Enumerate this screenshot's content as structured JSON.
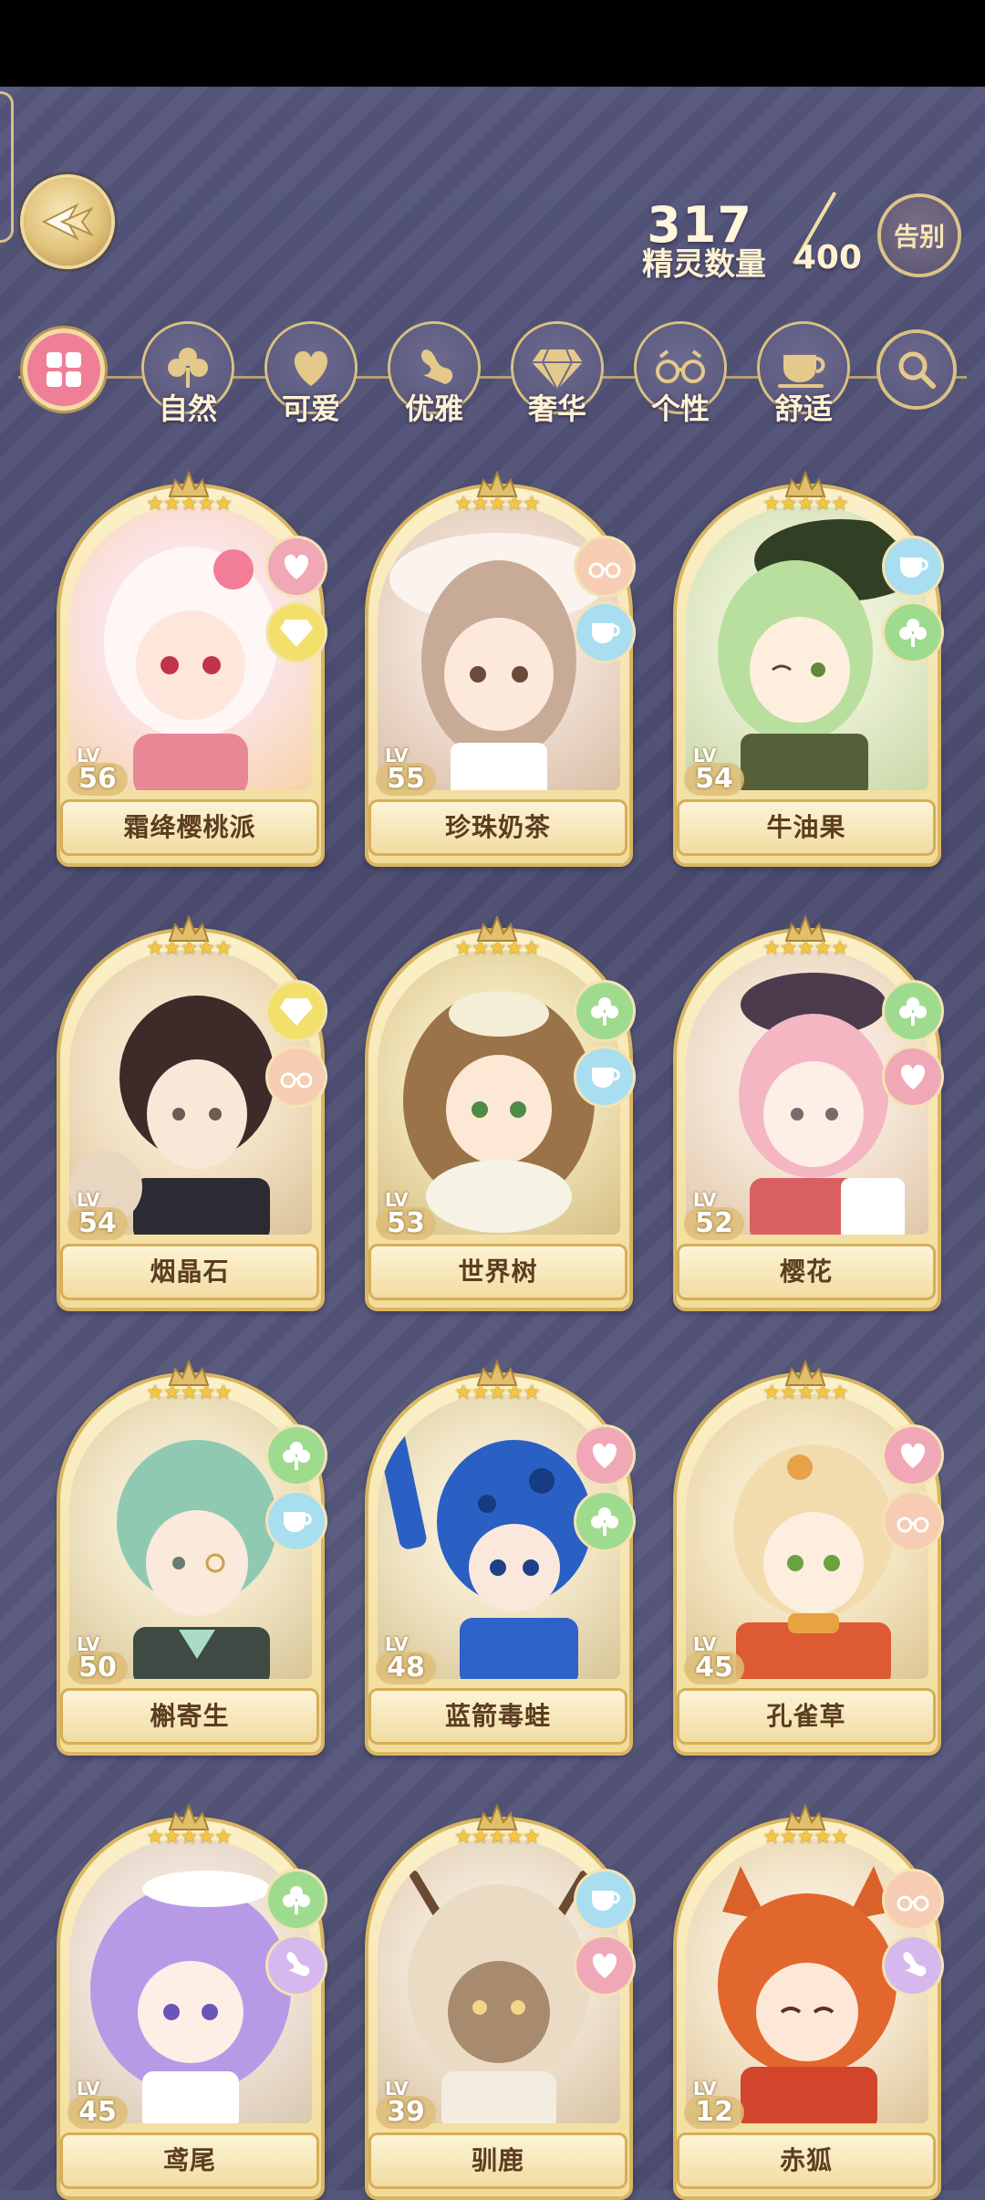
{
  "header": {
    "spirit_count": "317",
    "spirit_label": "精灵数量",
    "spirit_max": "400",
    "farewell_label": "告别"
  },
  "filters": [
    {
      "label": "自然",
      "icon": "clover-icon"
    },
    {
      "label": "可爱",
      "icon": "heart-icon"
    },
    {
      "label": "优雅",
      "icon": "swan-icon"
    },
    {
      "label": "奢华",
      "icon": "gem-icon"
    },
    {
      "label": "个性",
      "icon": "glasses-icon"
    },
    {
      "label": "舒适",
      "icon": "cup-icon"
    }
  ],
  "lv_prefix": "LV",
  "cards": [
    {
      "name": "霜绛樱桃派",
      "level": "56",
      "stars": "★★★★★",
      "badges": [
        "heart",
        "gem"
      ]
    },
    {
      "name": "珍珠奶茶",
      "level": "55",
      "stars": "★★★★★",
      "badges": [
        "glasses",
        "cup"
      ]
    },
    {
      "name": "牛油果",
      "level": "54",
      "stars": "★★★★★",
      "badges": [
        "cup",
        "clover"
      ]
    },
    {
      "name": "烟晶石",
      "level": "54",
      "stars": "★★★★★",
      "badges": [
        "gem",
        "glasses"
      ]
    },
    {
      "name": "世界树",
      "level": "53",
      "stars": "★★★★★",
      "badges": [
        "clover",
        "cup"
      ]
    },
    {
      "name": "樱花",
      "level": "52",
      "stars": "★★★★★",
      "badges": [
        "clover",
        "heart"
      ]
    },
    {
      "name": "槲寄生",
      "level": "50",
      "stars": "★★★★★",
      "badges": [
        "clover",
        "cup"
      ]
    },
    {
      "name": "蓝箭毒蛙",
      "level": "48",
      "stars": "★★★★★",
      "badges": [
        "heart",
        "clover"
      ]
    },
    {
      "name": "孔雀草",
      "level": "45",
      "stars": "★★★★★",
      "badges": [
        "heart",
        "glasses"
      ]
    },
    {
      "name": "鸢尾",
      "level": "45",
      "stars": "★★★★★",
      "badges": [
        "clover",
        "swan"
      ]
    },
    {
      "name": "驯鹿",
      "level": "39",
      "stars": "★★★★★",
      "badges": [
        "cup",
        "heart"
      ]
    },
    {
      "name": "赤狐",
      "level": "12",
      "stars": "★★★★★",
      "badges": [
        "glasses",
        "swan"
      ]
    }
  ],
  "colors": {
    "background": "#505176",
    "gold": "#d9b662",
    "card_bg": "#f7e4ac",
    "name_text": "#5b3d1f",
    "filter_all_active": "#ee7f97"
  }
}
